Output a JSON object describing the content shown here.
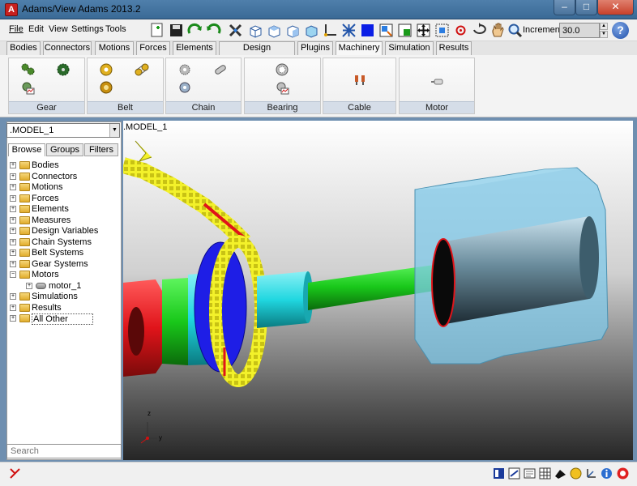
{
  "window": {
    "title": "Adams/View Adams 2013.2",
    "app_icon_letter": "A"
  },
  "menu": [
    {
      "label": "File"
    },
    {
      "label": "Edit"
    },
    {
      "label": "View"
    },
    {
      "label": "Settings"
    },
    {
      "label": "Tools"
    }
  ],
  "toolbar": {
    "increment_label": "Increment",
    "increment_value": "30.0",
    "help_label": "?",
    "icons": [
      "new-model-icon",
      "save-icon",
      "redo-icon",
      "undo-icon",
      "tools-icon",
      "view-front-icon",
      "view-top-icon",
      "view-right-icon",
      "view-iso-icon",
      "triad-icon",
      "network-icon",
      "fill-color-icon",
      "dynamic-translate-icon",
      "dynamic-rotate-icon",
      "fit-icon",
      "zoom-box-icon",
      "center-icon",
      "rotate-icon",
      "pan-icon",
      "zoom-icon"
    ]
  },
  "tabs": [
    {
      "label": "Bodies"
    },
    {
      "label": "Connectors"
    },
    {
      "label": "Motions"
    },
    {
      "label": "Forces"
    },
    {
      "label": "Elements"
    },
    {
      "label": "Design Exploration"
    },
    {
      "label": "Plugins"
    },
    {
      "label": "Machinery",
      "active": true
    },
    {
      "label": "Simulation"
    },
    {
      "label": "Results"
    }
  ],
  "ribbon": {
    "groups": [
      {
        "label": "Gear",
        "icons": [
          "gear-pair-icon",
          "gear-spur-icon",
          "gear-output-icon"
        ]
      },
      {
        "label": "Belt",
        "icons": [
          "belt-pulley-icon",
          "belt-link-icon",
          "belt-output-icon"
        ]
      },
      {
        "label": "Chain",
        "icons": [
          "chain-sprocket-icon",
          "chain-link-icon"
        ]
      },
      {
        "label": "Bearing",
        "icons": [
          "bearing-icon",
          "bearing-output-icon"
        ]
      },
      {
        "label": "Cable",
        "icons": [
          "cable-pulley-icon"
        ]
      },
      {
        "label": "Motor",
        "icons": [
          "motor-icon"
        ]
      }
    ]
  },
  "browser": {
    "model_select": ".MODEL_1",
    "tabs": [
      {
        "label": "Browse",
        "active": true
      },
      {
        "label": "Groups"
      },
      {
        "label": "Filters"
      }
    ],
    "tree": [
      {
        "label": "Bodies",
        "expander": "+"
      },
      {
        "label": "Connectors",
        "expander": "+"
      },
      {
        "label": "Motions",
        "expander": "+"
      },
      {
        "label": "Forces",
        "expander": "+"
      },
      {
        "label": "Elements",
        "expander": "+"
      },
      {
        "label": "Measures",
        "expander": "+"
      },
      {
        "label": "Design Variables",
        "expander": "+"
      },
      {
        "label": "Chain Systems",
        "expander": "+"
      },
      {
        "label": "Belt Systems",
        "expander": "+"
      },
      {
        "label": "Gear Systems",
        "expander": "+"
      },
      {
        "label": "Motors",
        "expander": "−"
      },
      {
        "label": "motor_1",
        "expander": "+",
        "child": true
      },
      {
        "label": "Simulations",
        "expander": "+"
      },
      {
        "label": "Results",
        "expander": "+"
      },
      {
        "label": "All Other",
        "expander": "+",
        "selected": true
      }
    ],
    "search_placeholder": "Search"
  },
  "viewport": {
    "model_label": ".MODEL_1",
    "triad": {
      "z": "z",
      "y": "y"
    },
    "colors": {
      "chain": "#f3f12a",
      "sprocket": "#1e1ee6",
      "shaft": "#19c81a",
      "hub": "#20d7e0",
      "flange": "#e0141a",
      "motor_housing": "#7fc8e8",
      "motor_core": "#4a6f80"
    }
  },
  "statusbar": {
    "icons": [
      "toggle-icon",
      "browser-icon",
      "info-icon",
      "message-icon",
      "table-icon",
      "shading-icon",
      "units-icon",
      "coordinate-icon",
      "stop-icon"
    ]
  }
}
